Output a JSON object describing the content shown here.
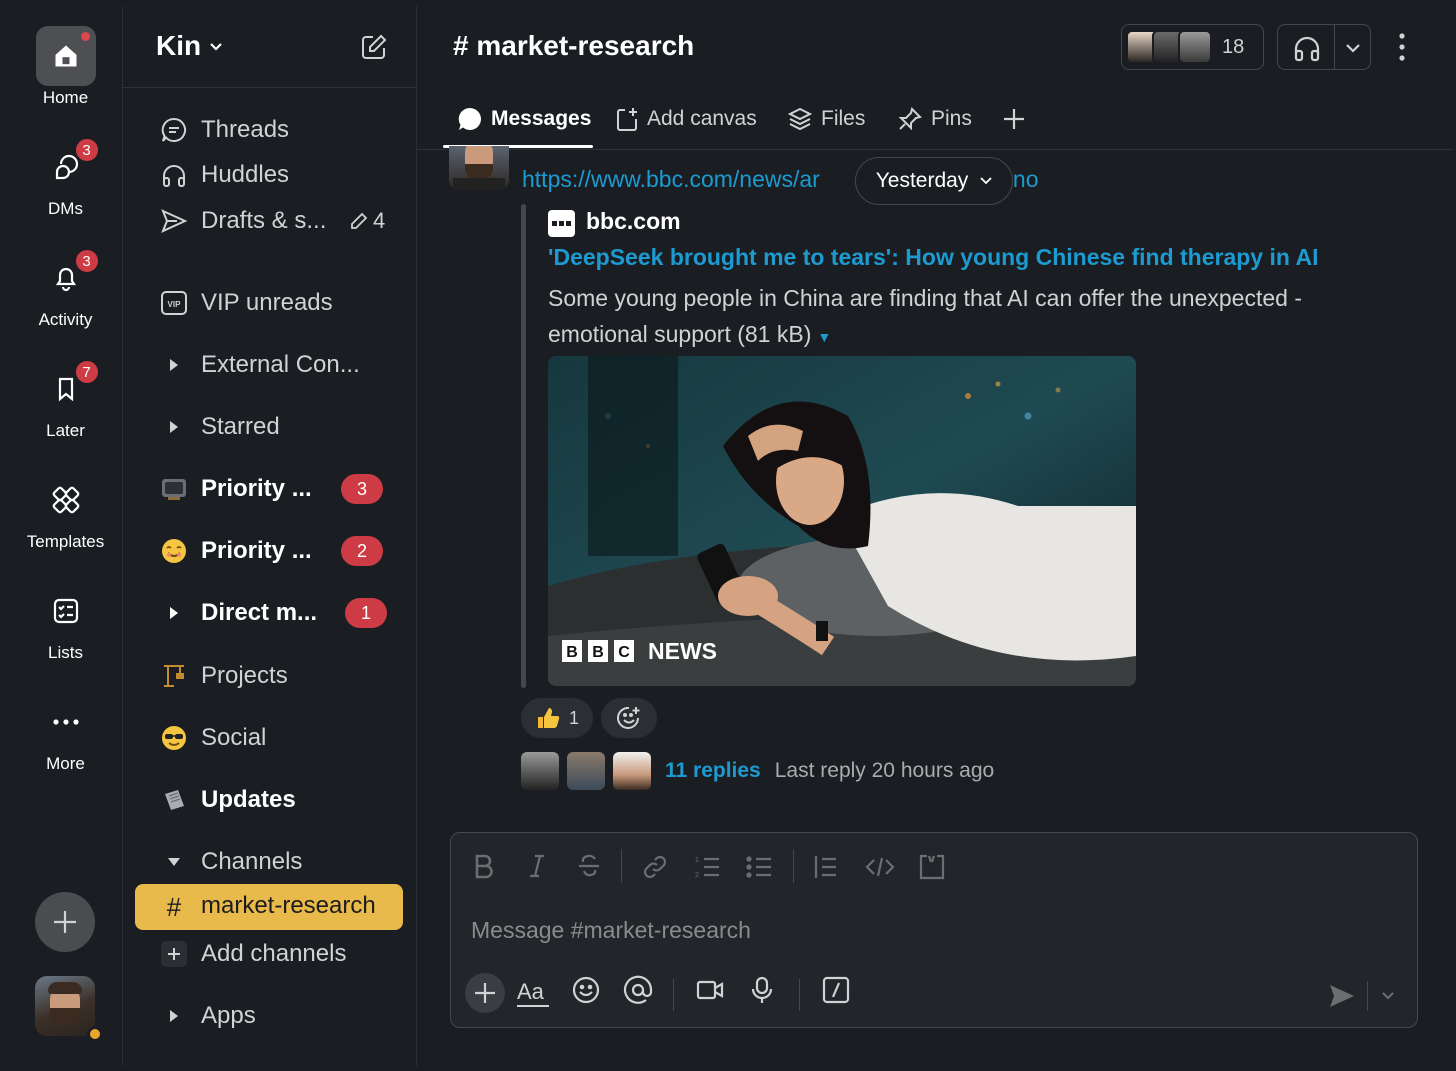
{
  "rail": {
    "home_label": "Home",
    "dms_label": "DMs",
    "dms_badge": "3",
    "activity_label": "Activity",
    "activity_badge": "3",
    "later_label": "Later",
    "later_badge": "7",
    "templates_label": "Templates",
    "lists_label": "Lists",
    "more_label": "More"
  },
  "workspace": {
    "name": "Kin"
  },
  "sidebar": {
    "threads": "Threads",
    "huddles": "Huddles",
    "drafts": "Drafts & s...",
    "drafts_count": "4",
    "vip": "VIP unreads",
    "external": "External Con...",
    "starred": "Starred",
    "priority1": "Priority ...",
    "priority1_badge": "3",
    "priority2": "Priority ...",
    "priority2_badge": "2",
    "direct": "Direct m...",
    "direct_badge": "1",
    "projects": "Projects",
    "social": "Social",
    "updates": "Updates",
    "channels": "Channels",
    "active_channel": "market-research",
    "add_channels": "Add channels",
    "apps": "Apps"
  },
  "header": {
    "channel_title": "# market-research",
    "member_count": "18"
  },
  "tabs": {
    "messages": "Messages",
    "add_canvas": "Add canvas",
    "files": "Files",
    "pins": "Pins"
  },
  "message": {
    "link_start": "https://www.bbc.com/news/ar",
    "link_end": "2nxno",
    "date_divider": "Yesterday",
    "unfurl": {
      "site": "bbc.com",
      "title": "'DeepSeek brought me to tears': How young Chinese find therapy in AI",
      "description": "Some young people in China are finding that AI can offer the unexpected - emotional support (81 kB)",
      "image_brand": "NEWS"
    },
    "reaction_count": "1",
    "replies": "11 replies",
    "last_reply": "Last reply 20 hours ago"
  },
  "composer": {
    "placeholder": "Message #market-research"
  },
  "colors": {
    "accent_link": "#1d9bd1",
    "active_channel_bg": "#e8b94b",
    "badge": "#cd3b45",
    "background": "#1a1d21"
  }
}
